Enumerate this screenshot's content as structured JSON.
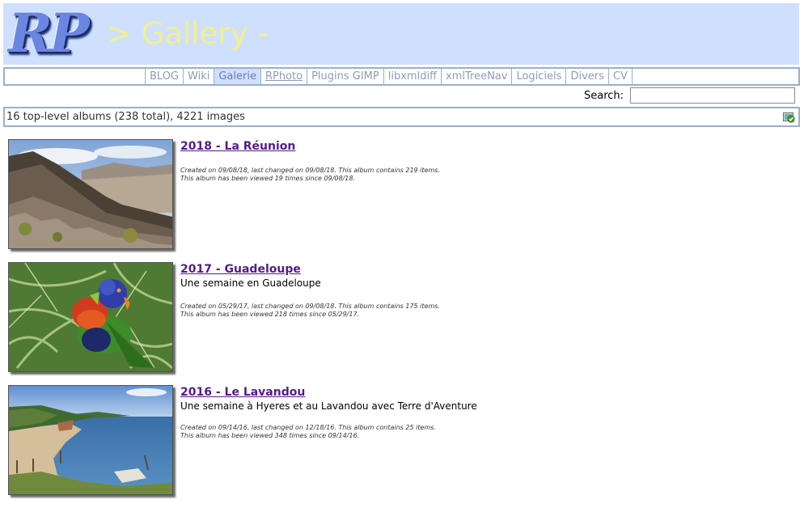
{
  "header": {
    "logo_text": "RP",
    "title": "> Gallery -"
  },
  "nav": {
    "items": [
      {
        "label": "BLOG"
      },
      {
        "label": "Wiki"
      },
      {
        "label": "Galerie"
      },
      {
        "label": "RPhoto"
      },
      {
        "label": "Plugins GIMP"
      },
      {
        "label": "libxmldiff"
      },
      {
        "label": "xmlTreeNav"
      },
      {
        "label": "Logiciels"
      },
      {
        "label": "Divers"
      },
      {
        "label": "CV"
      }
    ],
    "active": "Galerie"
  },
  "search": {
    "label": "Search:",
    "value": ""
  },
  "summary": {
    "text": "16 top-level albums (238 total), 4221 images",
    "icon": "slideshow-icon"
  },
  "albums": [
    {
      "title": "2018 - La Réunion",
      "description": "",
      "meta_line1": "Created on 09/08/18, last changed on 09/08/18. This album contains 219 items.",
      "meta_line2": "This album has been viewed 19 times since 09/08/18."
    },
    {
      "title": "2017 - Guadeloupe",
      "description": "Une semaine en Guadeloupe",
      "meta_line1": "Created on 05/29/17, last changed on 09/08/18. This album contains 175 items.",
      "meta_line2": "This album has been viewed 218 times since 05/29/17."
    },
    {
      "title": "2016 - Le Lavandou",
      "description": "Une semaine à Hyeres et au Lavandou avec Terre d'Aventure",
      "meta_line1": "Created on 09/14/16, last changed on 12/18/16. This album contains 25 items.",
      "meta_line2": "This album has been viewed 348 times since 09/14/16."
    }
  ]
}
